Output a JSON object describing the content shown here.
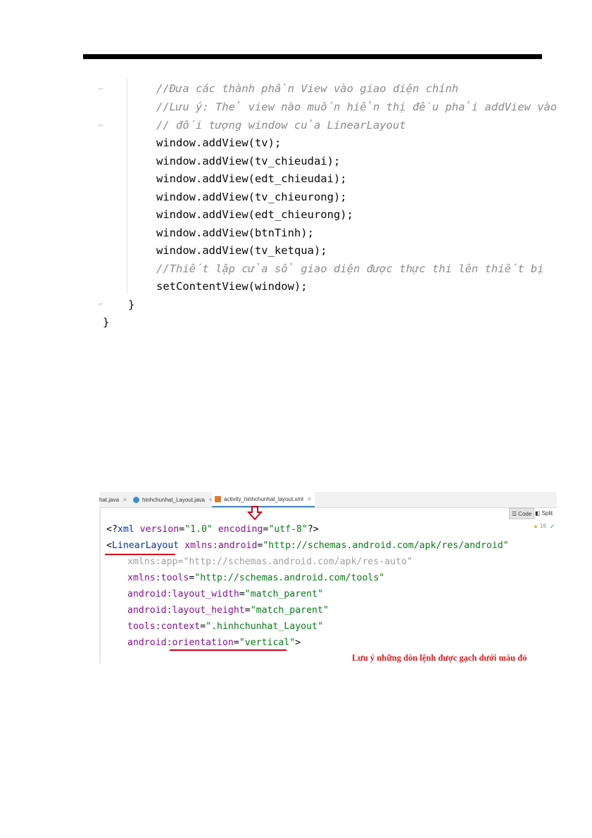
{
  "java_code": {
    "comment_1": "//Đưa các thành phần View vào giao diện chính",
    "comment_2": "//Lưu ý: Thẻ view nào muốn hiển thị đều phải addView vào",
    "comment_3": "// đối tượng window của LinearLayout",
    "statements": [
      "window.addView(tv);",
      "window.addView(tv_chieudai);",
      "window.addView(edt_chieudai);",
      "window.addView(tv_chieurong);",
      "window.addView(edt_chieurong);",
      "window.addView(btnTinh);",
      "window.addView(tv_ketqua);"
    ],
    "comment_4": "//Thiết lập cửa sổ giao diện được thực thi lên thiết bị",
    "set_content": "setContentView(window);",
    "close_method": "}",
    "close_class": "}"
  },
  "ide": {
    "tabs": [
      {
        "label": "hat.java",
        "icon": "java-class-icon",
        "active": false
      },
      {
        "label": "hinhchunhat_Layout.java",
        "icon": "java-class-icon",
        "active": false
      },
      {
        "label": "activity_hinhchunhat_layout.xml",
        "icon": "xml-file-icon",
        "active": true
      }
    ],
    "code_button": "Code",
    "split_button": "Split",
    "warning_count": "16",
    "xml": {
      "decl_open": "<?",
      "decl_name": "xml",
      "version_attr": " version",
      "version_val": "\"1.0\"",
      "encoding_attr": " encoding",
      "encoding_val": "\"utf-8\"",
      "decl_close": "?>",
      "tag_open": "<",
      "tag_name": "LinearLayout",
      "xmlns_android_ns": " xmlns:",
      "xmlns_android_attr": "android",
      "xmlns_android_val": "\"http://schemas.android.com/apk/res/android\"",
      "xmlns_app": "xmlns:app=\"http://schemas.android.com/apk/res-auto\"",
      "xmlns_tools_ns": "xmlns:",
      "xmlns_tools_attr": "tools",
      "xmlns_tools_val": "\"http://schemas.android.com/tools\"",
      "width_attr": "android:layout_width",
      "width_val": "\"match_parent\"",
      "height_attr": "android:layout_height",
      "height_val": "\"match_parent\"",
      "context_attr": "tools:context",
      "context_val": "\".hinhchunhat_Layout\"",
      "orient_ns": "android:",
      "orient_attr": "orientation",
      "orient_val": "\"vertical\"",
      "orient_close": ">",
      "eq": "="
    },
    "note": "Lưu ý những dòn lệnh được gạch dưới màu đỏ",
    "accent_red": "#d0021b"
  }
}
